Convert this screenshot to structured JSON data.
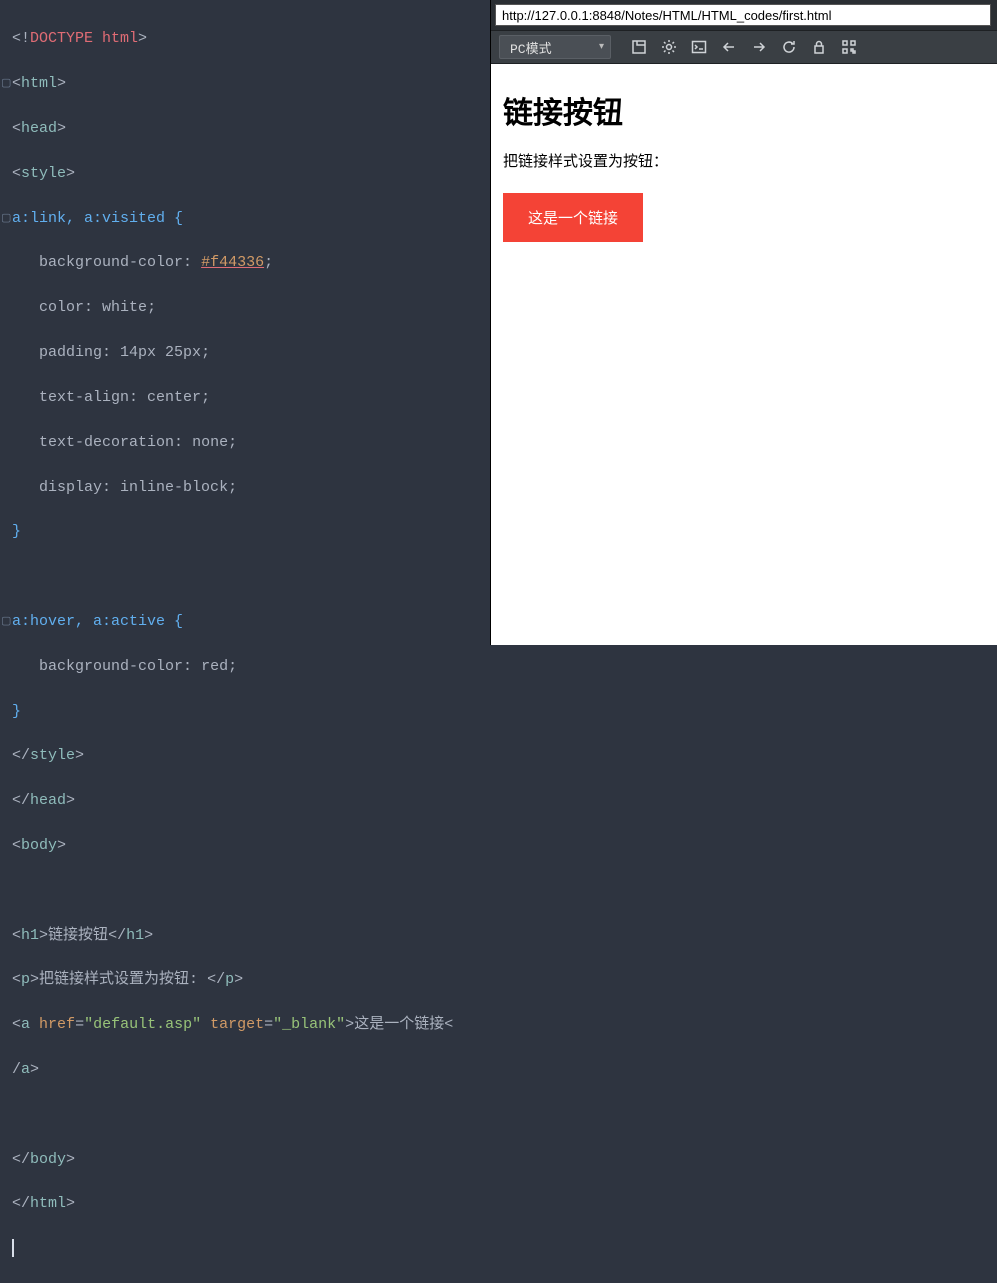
{
  "code": {
    "doctype_open": "<!",
    "doctype_word": "DOCTYPE html",
    "doctype_close": ">",
    "selector_link": "a:link, a:visited {",
    "prop_bg": "background-color",
    "val_bg": "#f44336",
    "prop_color": "color",
    "val_color": "white",
    "prop_padding": "padding",
    "val_padding": "14px 25px",
    "prop_align": "text-align",
    "val_align": "center",
    "prop_deco": "text-decoration",
    "val_deco": "none",
    "prop_display": "display",
    "val_display": "inline-block",
    "selector_hover": "a:hover, a:active {",
    "prop_bg2": "background-color",
    "val_bg2": "red",
    "h1_text": "链接按钮",
    "p_text": "把链接样式设置为按钮: ",
    "a_href": "\"default.asp\"",
    "a_target": "\"_blank\"",
    "a_text": "这是一个链接"
  },
  "browser": {
    "url": "http://127.0.0.1:8848/Notes/HTML/HTML_codes/first.html",
    "mode_label": "PC模式"
  },
  "rendered": {
    "heading": "链接按钮",
    "paragraph": "把链接样式设置为按钮：",
    "link_label": "这是一个链接"
  }
}
